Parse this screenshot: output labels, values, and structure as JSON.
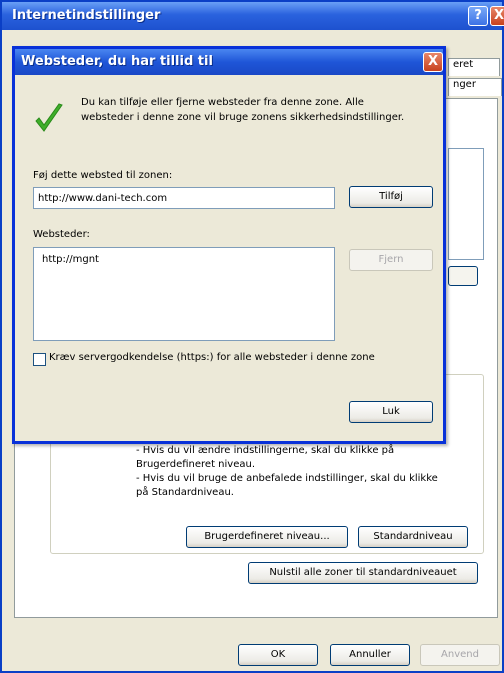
{
  "back_window": {
    "title": "Internetindstillinger",
    "help_label": "?",
    "close_label": "X",
    "tab_fragments": [
      "eret",
      "nger"
    ],
    "level_text": [
      "- Hvis du vil ændre indstillingerne, skal du klikke på",
      "Brugerdefineret niveau.",
      "- Hvis du vil bruge de anbefalede indstillinger, skal du klikke",
      "på Standardniveau."
    ],
    "custom_level_label": "Brugerdefineret niveau...",
    "default_level_label": "Standardniveau",
    "reset_all_label": "Nulstil alle zoner til standardniveauet",
    "ok_label": "OK",
    "cancel_label": "Annuller",
    "apply_label": "Anvend"
  },
  "dialog": {
    "title": "Websteder, du har tillid til",
    "close_label": "X",
    "info_lines": [
      "Du kan tilføje eller fjerne websteder fra denne zone. Alle",
      "websteder i denne zone vil bruge zonens sikkerhedsindstillinger."
    ],
    "add_label": "Føj dette websted til zonen:",
    "add_value": "http://www.dani-tech.com",
    "add_button": "Tilføj",
    "sites_label": "Websteder:",
    "sites": [
      "http://mgnt"
    ],
    "remove_button": "Fjern",
    "require_https_label": "Kræv servergodkendelse (https:) for alle websteder i denne zone",
    "require_https_checked": false,
    "close_button": "Luk"
  },
  "colors": {
    "titlebar": "#1f56d8",
    "dialog_face": "#ece9d8",
    "close_red": "#c8411e",
    "check_green": "#3fae2a"
  },
  "icons": {
    "check": "checkmark-icon",
    "close": "close-icon",
    "help": "help-icon"
  }
}
